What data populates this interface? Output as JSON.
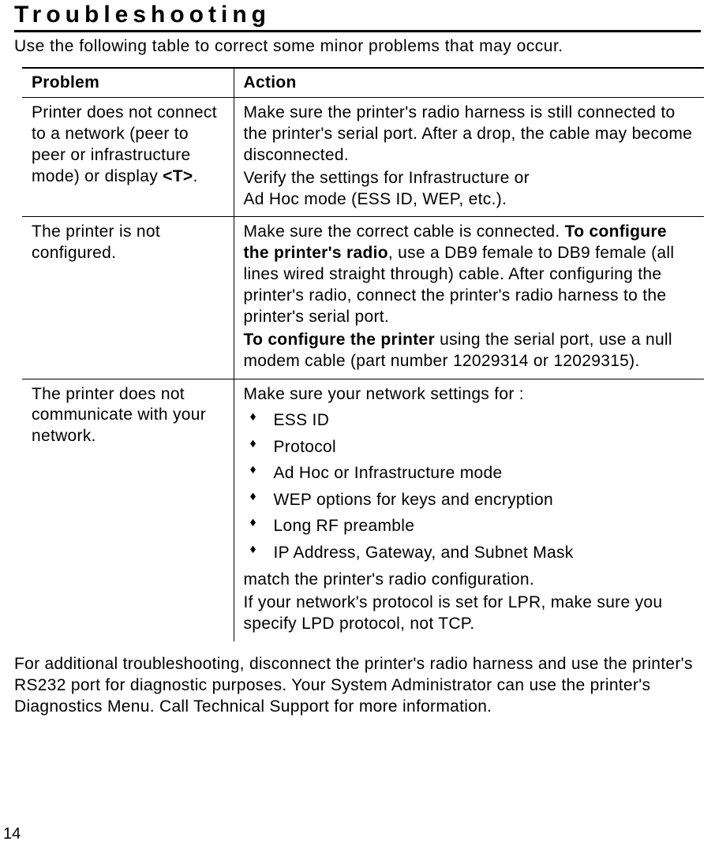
{
  "title": "Troubleshooting",
  "intro": "Use the following table to correct some minor problems that may occur.",
  "headers": {
    "problem": "Problem",
    "action": "Action"
  },
  "rows": {
    "r1": {
      "problem_a": "Printer does not connect to a network (peer to peer or infrastructure mode) or display ",
      "problem_b": "<T>",
      "problem_c": ".",
      "action_p1": "Make sure the printer's radio harness is still connected to the printer's serial port.  After a drop, the cable may become disconnected.",
      "action_p2a": "Verify the settings for Infrastructure or",
      "action_p2b": "Ad Hoc mode (ESS ID, WEP, etc.)."
    },
    "r2": {
      "problem": "The printer is not configured.",
      "action_p1a": "Make sure the correct cable is connected.  ",
      "action_p1b": "To configure the printer's radio",
      "action_p1c": ", use a DB9 female to DB9 female (all lines wired straight through) cable.  After configuring the printer's radio, connect the printer's radio harness to the printer's serial port.",
      "action_p2a": "To configure the printer",
      "action_p2b": " using the serial port, use a null modem cable (part number 12029314 or 12029315)."
    },
    "r3": {
      "problem": "The printer does not communicate with your network.",
      "action_intro": "Make sure your network settings for :",
      "items": {
        "i1": "ESS ID",
        "i2": "Protocol",
        "i3": "Ad Hoc or Infrastructure mode",
        "i4": "WEP options for keys and encryption",
        "i5": "Long RF preamble",
        "i6": "IP Address, Gateway, and Subnet Mask"
      },
      "action_post1": "match the printer's radio configuration.",
      "action_post2": "If your network's protocol is set for LPR, make sure you specify LPD protocol, not TCP."
    }
  },
  "footer": "For additional troubleshooting, disconnect the printer's radio harness and use the printer's RS232 port for diagnostic purposes.  Your System Administrator can use the printer's Diagnostics Menu.  Call Technical Support for more information.",
  "page_number": "14"
}
